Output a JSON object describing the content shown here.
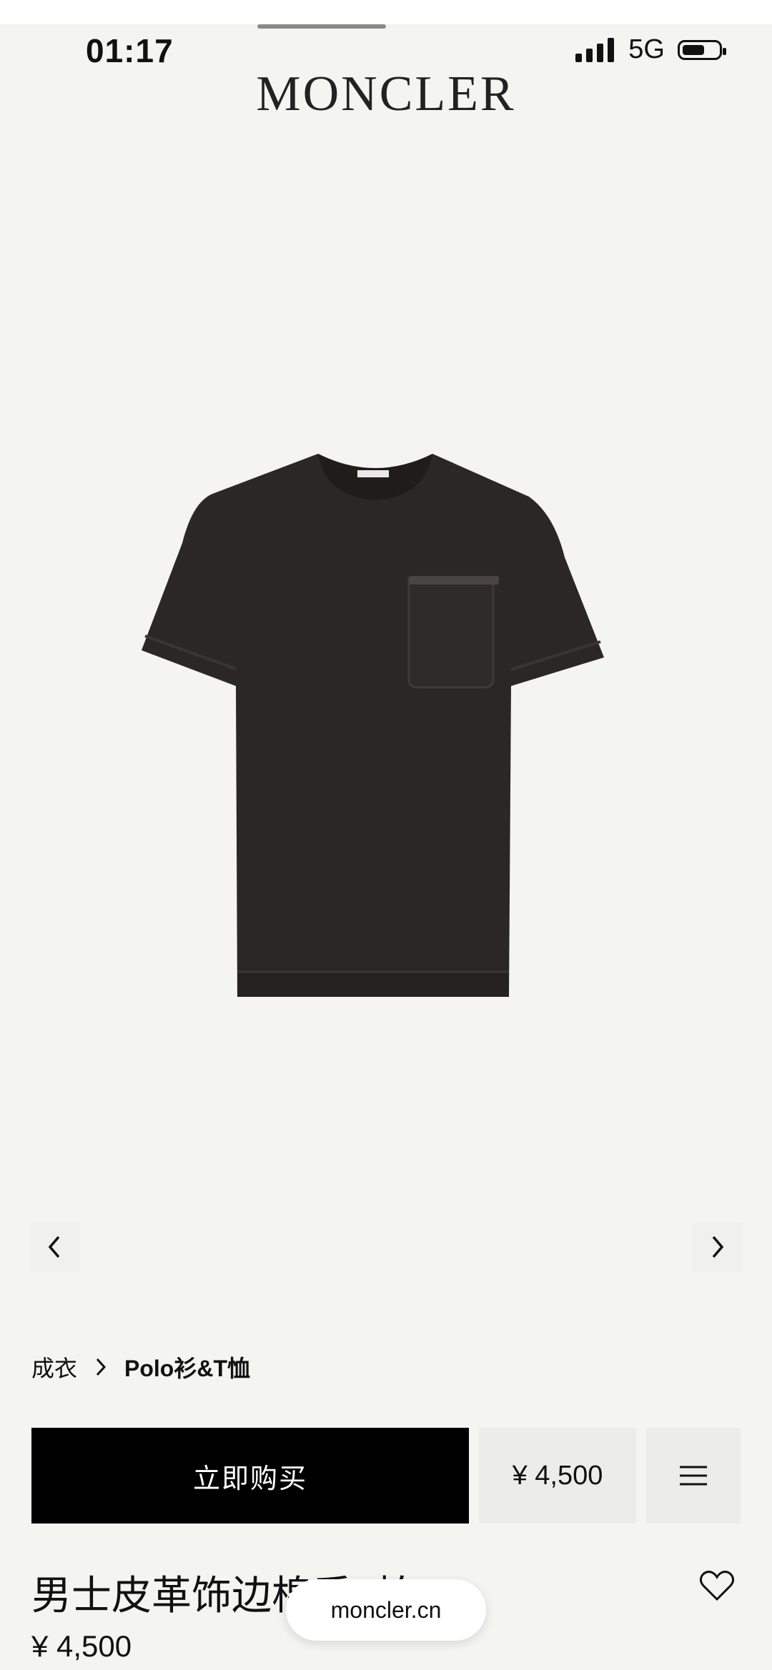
{
  "status_bar": {
    "time": "01:17",
    "network": "5G",
    "battery_level": 0.5
  },
  "header": {
    "brand": "MONCLER"
  },
  "gallery": {
    "image_desc": "dark brown t-shirt with chest pocket",
    "prev_icon": "chevron-left-icon",
    "next_icon": "chevron-right-icon"
  },
  "breadcrumb": {
    "parent": "成衣",
    "current": "Polo衫&T恤",
    "separator_icon": "chevron-right-icon"
  },
  "actions": {
    "buy_label": "立即购买",
    "price_label": "¥ 4,500",
    "menu_icon": "menu-icon"
  },
  "product": {
    "title": "男士皮革饰边棉质T恤",
    "price": "¥ 4,500",
    "wishlist_icon": "heart-icon"
  },
  "browser": {
    "domain": "moncler.cn"
  },
  "colors": {
    "background": "#f4f4f0",
    "primary_button": "#000000",
    "shirt": "#2b2725"
  }
}
